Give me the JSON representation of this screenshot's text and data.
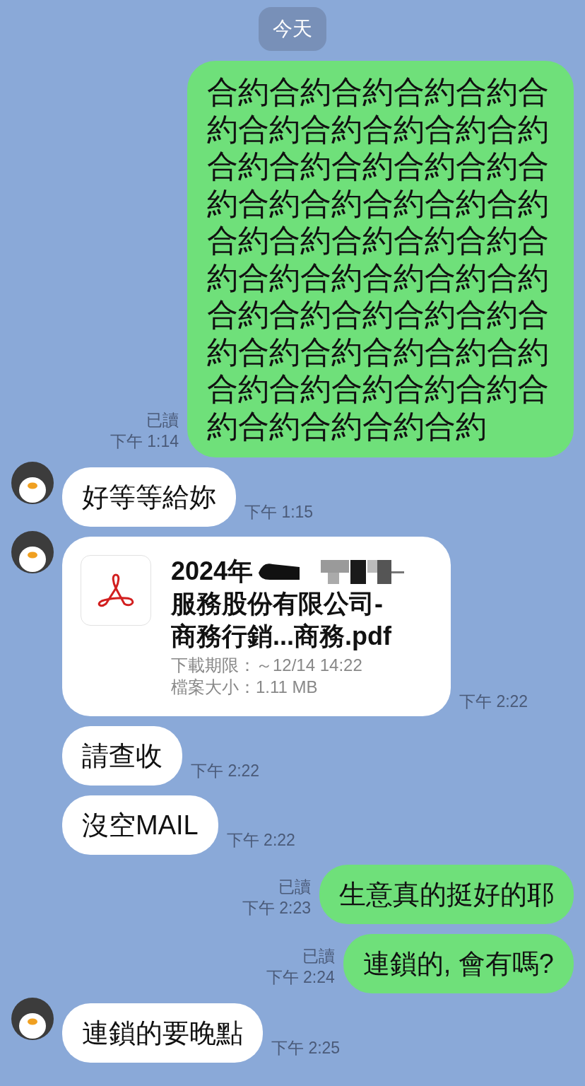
{
  "date_pill": "今天",
  "messages": [
    {
      "kind": "text",
      "sent": true,
      "read_label": "已讀",
      "time": "下午 1:14",
      "text": "合約合約合約合約合約合約合約合約合約合約合約合約合約合約合約合約合約合約合約合約合約合約合約合約合約合約合約合約合約合約合約合約合約合約合約合約合約合約合約合約合約合約合約合約合約合約合約合約合約合約合約合約合約合約"
    },
    {
      "kind": "text",
      "sent": false,
      "avatar": true,
      "time": "下午 1:15",
      "text": "好等等給妳"
    },
    {
      "kind": "file",
      "sent": false,
      "avatar": true,
      "time": "下午 2:22",
      "name_lines": [
        "2024年",
        "服務股份有限公司-",
        "商務行銷...商務.pdf"
      ],
      "redacted": true,
      "expiry": "下載期限：～12/14 14:22",
      "size": "檔案大小：1.11 MB"
    },
    {
      "kind": "text",
      "sent": false,
      "avatar": false,
      "time": "下午 2:22",
      "text": "請查收"
    },
    {
      "kind": "text",
      "sent": false,
      "avatar": false,
      "time": "下午 2:22",
      "text": "沒空MAIL"
    },
    {
      "kind": "text",
      "sent": true,
      "read_label": "已讀",
      "time": "下午 2:23",
      "text": "生意真的挺好的耶"
    },
    {
      "kind": "text",
      "sent": true,
      "read_label": "已讀",
      "time": "下午 2:24",
      "text": "連鎖的, 會有嗎?"
    },
    {
      "kind": "text",
      "sent": false,
      "avatar": true,
      "time": "下午 2:25",
      "text": "連鎖的要晚點"
    }
  ]
}
